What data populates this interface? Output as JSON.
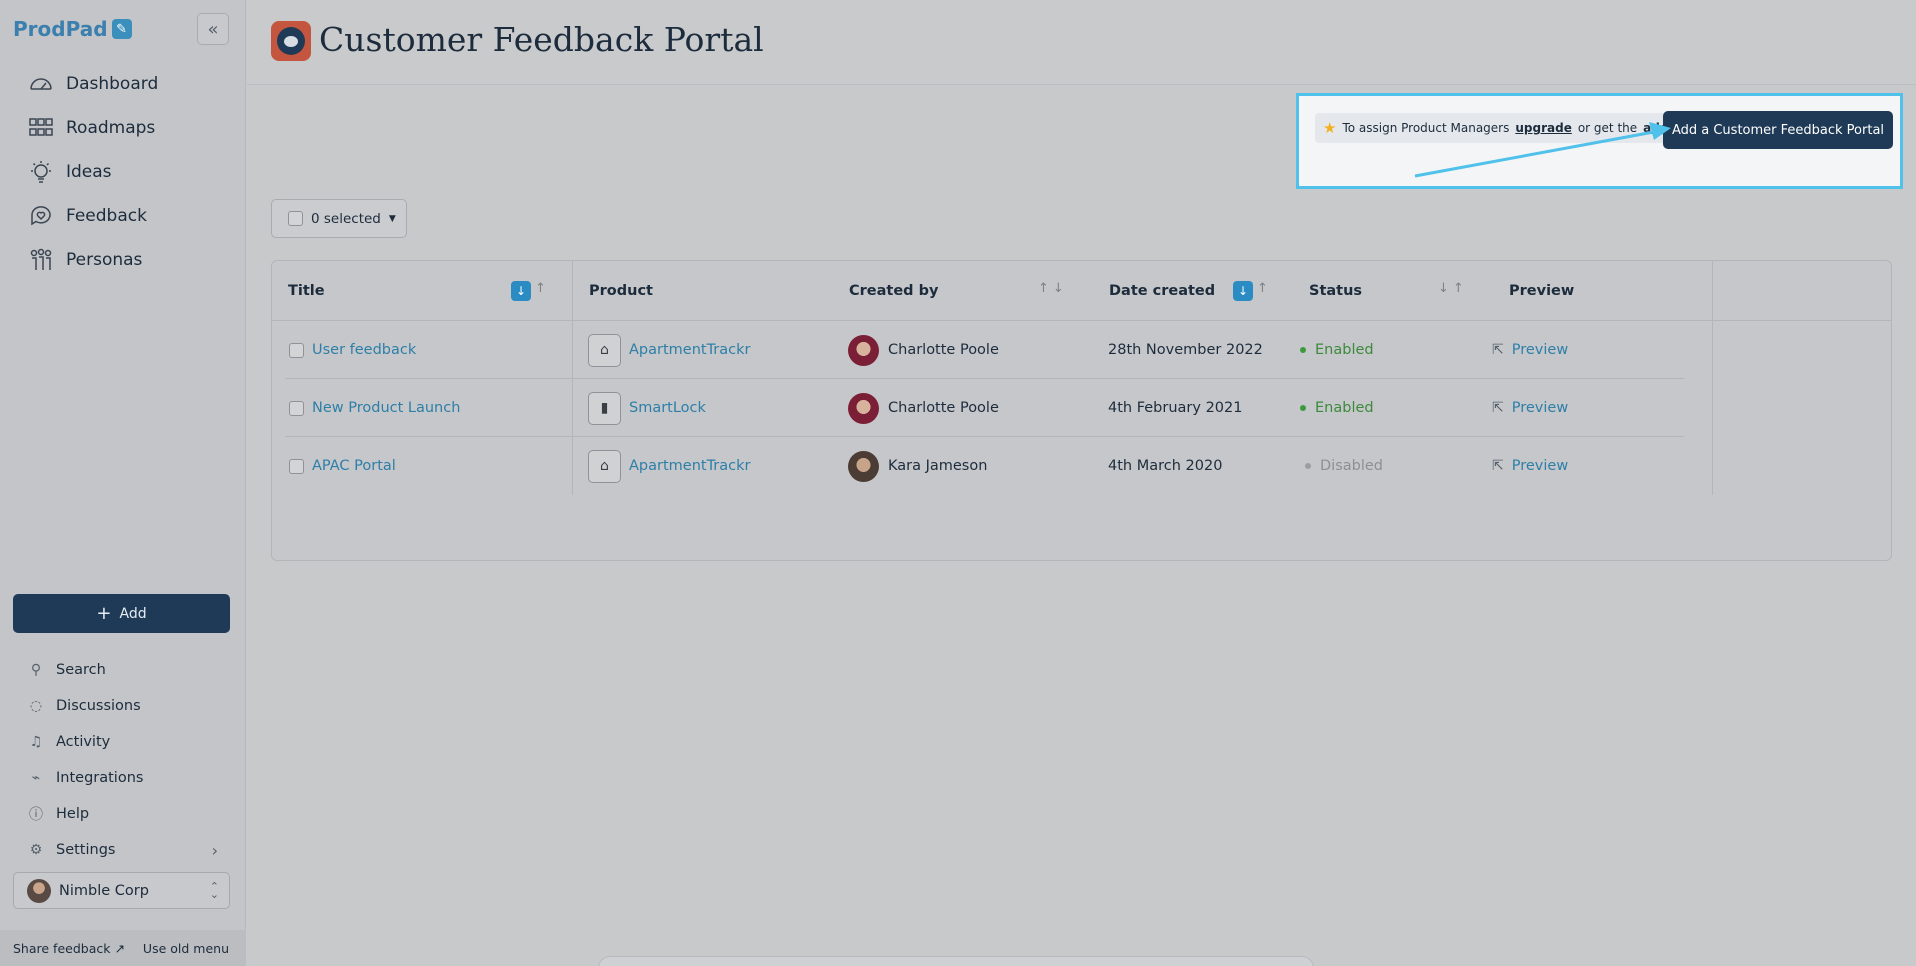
{
  "brand": {
    "name": "ProdPad"
  },
  "sidebar": {
    "nav": [
      {
        "label": "Dashboard",
        "icon": "dashboard-icon"
      },
      {
        "label": "Roadmaps",
        "icon": "roadmaps-icon"
      },
      {
        "label": "Ideas",
        "icon": "ideas-icon"
      },
      {
        "label": "Feedback",
        "icon": "feedback-icon"
      },
      {
        "label": "Personas",
        "icon": "personas-icon"
      }
    ],
    "add_label": "Add",
    "bottom": [
      {
        "label": "Search",
        "icon": "search-icon"
      },
      {
        "label": "Discussions",
        "icon": "discussions-icon"
      },
      {
        "label": "Activity",
        "icon": "bell-icon"
      },
      {
        "label": "Integrations",
        "icon": "plug-icon"
      },
      {
        "label": "Help",
        "icon": "help-icon"
      },
      {
        "label": "Settings",
        "icon": "gear-icon"
      }
    ],
    "org": "Nimble Corp",
    "footer": {
      "share_feedback": "Share feedback",
      "old_menu": "Use old menu"
    }
  },
  "header": {
    "title": "Customer Feedback Portal"
  },
  "notice": {
    "prefix": "To assign Product Managers",
    "upgrade": "upgrade",
    "middle": "or get the",
    "addon": "addon"
  },
  "primary_button": "Add a Customer Feedback Portal",
  "selector": {
    "label": "0 selected"
  },
  "table": {
    "columns": [
      "Title",
      "Product",
      "Created by",
      "Date created",
      "Status",
      "Preview"
    ],
    "rows": [
      {
        "title": "User feedback",
        "product": "ApartmentTrackr",
        "created_by": "Charlotte Poole",
        "date": "28th November 2022",
        "status": "Enabled",
        "preview": "Preview"
      },
      {
        "title": "New Product Launch",
        "product": "SmartLock",
        "created_by": "Charlotte Poole",
        "date": "4th February 2021",
        "status": "Enabled",
        "preview": "Preview"
      },
      {
        "title": "APAC Portal",
        "product": "ApartmentTrackr",
        "created_by": "Kara Jameson",
        "date": "4th March 2020",
        "status": "Disabled",
        "preview": "Preview"
      }
    ]
  },
  "colors": {
    "primary": "#1f3a57",
    "accent": "#2a8cc2",
    "highlight": "#4fc1ea",
    "enabled": "#3c9a3c"
  }
}
